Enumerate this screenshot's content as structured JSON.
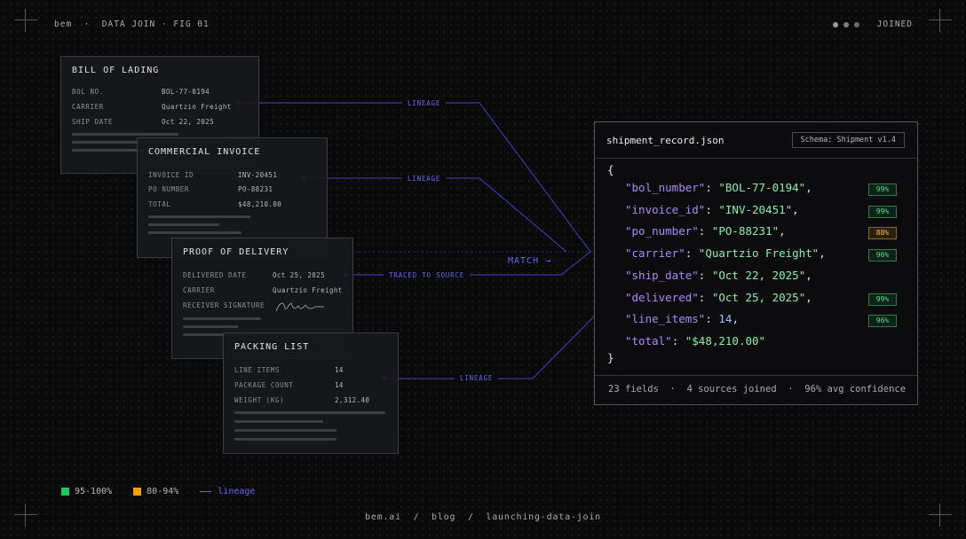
{
  "header": {
    "left": "bem  ·  DATA JOIN · FIG 01",
    "status": "JOINED"
  },
  "docs": {
    "bol": {
      "title": "BILL OF LADING",
      "rows": [
        {
          "k": "BOL NO.",
          "v": "BOL-77-0194"
        },
        {
          "k": "CARRIER",
          "v": "Quartzio Freight"
        },
        {
          "k": "SHIP DATE",
          "v": "Oct 22, 2025"
        }
      ]
    },
    "invoice": {
      "title": "COMMERCIAL INVOICE",
      "rows": [
        {
          "k": "INVOICE ID",
          "v": "INV-20451"
        },
        {
          "k": "PO NUMBER",
          "v": "PO-88231"
        },
        {
          "k": "TOTAL",
          "v": "$48,210.00"
        }
      ]
    },
    "pod": {
      "title": "PROOF OF DELIVERY",
      "rows": [
        {
          "k": "DELIVERED DATE",
          "v": "Oct 25, 2025"
        },
        {
          "k": "CARRIER",
          "v": "Quartzio Freight"
        },
        {
          "k": "RECEIVER SIGNATURE",
          "v": ""
        }
      ]
    },
    "packing": {
      "title": "PACKING LIST",
      "rows": [
        {
          "k": "LINE ITEMS",
          "v": "14"
        },
        {
          "k": "PACKAGE COUNT",
          "v": "14"
        },
        {
          "k": "WEIGHT (KG)",
          "v": "2,312.40"
        }
      ]
    }
  },
  "tags": {
    "lineage": "LINEAGE",
    "traced": "TRACED TO SOURCE",
    "match": "MATCH →"
  },
  "json": {
    "filename": "shipment_record.json",
    "schema": "Schema: Shipment v1.4",
    "open": "{",
    "close": "}",
    "fields": [
      {
        "key": "\"bol_number\"",
        "value": "\"BOL-77-0194\"",
        "type": "str",
        "comma": ",",
        "conf": "99%",
        "level": "high"
      },
      {
        "key": "\"invoice_id\"",
        "value": "\"INV-20451\"",
        "type": "str",
        "comma": ",",
        "conf": "99%",
        "level": "high"
      },
      {
        "key": "\"po_number\"",
        "value": "\"PO-88231\"",
        "type": "str",
        "comma": ",",
        "conf": "88%",
        "level": "mid"
      },
      {
        "key": "\"carrier\"",
        "value": "\"Quartzio Freight\"",
        "type": "str",
        "comma": ",",
        "conf": "96%",
        "level": "high"
      },
      {
        "key": "\"ship_date\"",
        "value": "\"Oct 22, 2025\"",
        "type": "str",
        "comma": ",",
        "conf": "",
        "level": ""
      },
      {
        "key": "\"delivered\"",
        "value": "\"Oct 25, 2025\"",
        "type": "str",
        "comma": ",",
        "conf": "99%",
        "level": "high"
      },
      {
        "key": "\"line_items\"",
        "value": "14",
        "type": "num",
        "comma": ",",
        "conf": "96%",
        "level": "high"
      },
      {
        "key": "\"total\"",
        "value": "\"$48,210.00\"",
        "type": "str",
        "comma": "",
        "conf": "",
        "level": ""
      }
    ],
    "stats": "23 fields  ·  4 sources joined  ·  96% avg confidence"
  },
  "legend": {
    "high": "95-100%",
    "mid": "80-94%",
    "lineage": "lineage"
  },
  "footer": {
    "url": "bem.ai  /  blog  /  launching-data-join"
  },
  "colors": {
    "accent": "#6366f1",
    "high": "#22c55e",
    "mid": "#f59e0b"
  }
}
